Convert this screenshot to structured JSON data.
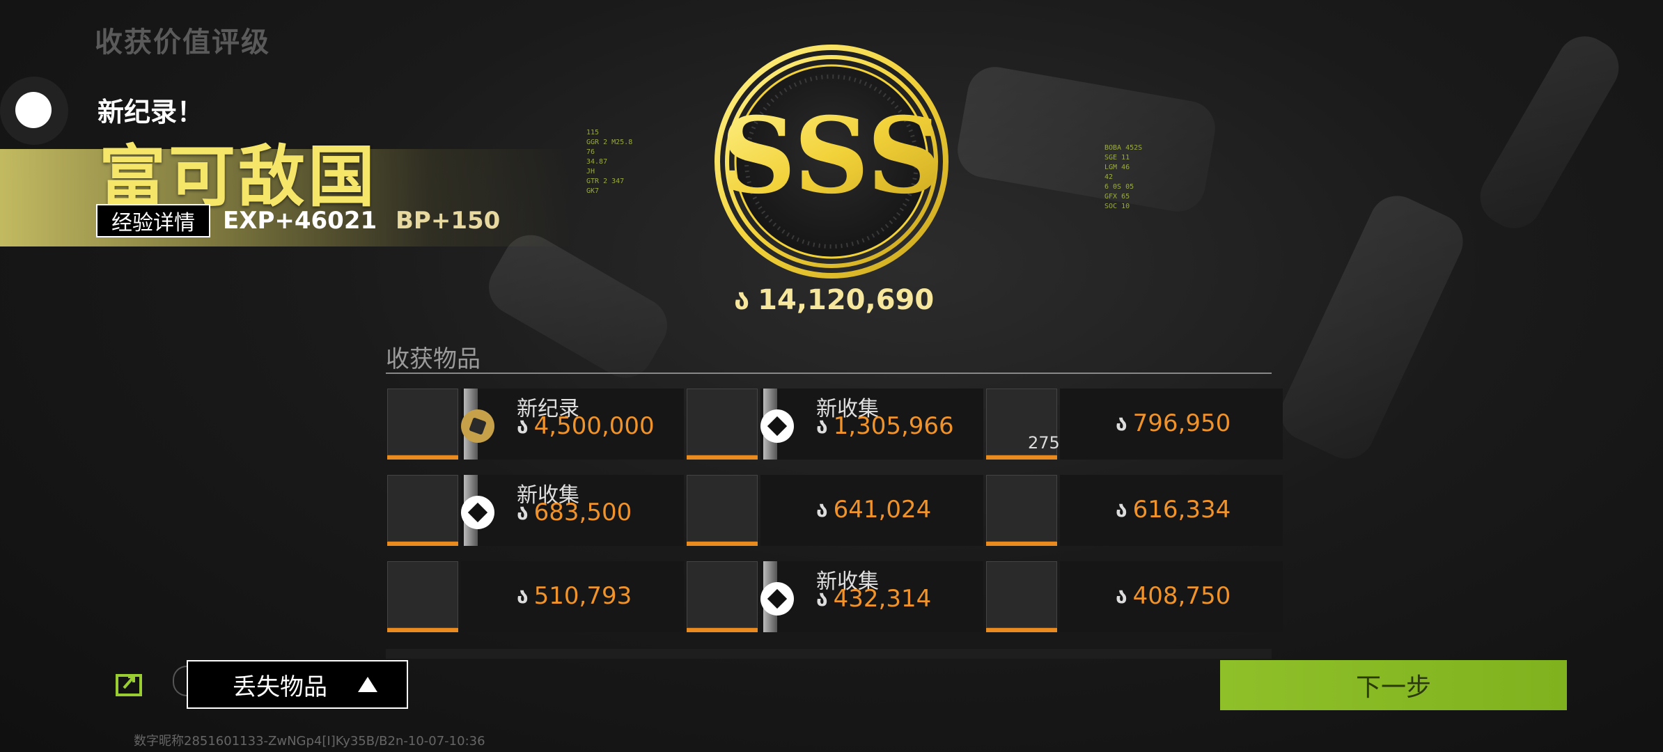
{
  "header": {
    "title": "收获价值评级"
  },
  "record": {
    "label": "新纪录！",
    "title": "富可敌国",
    "exp_button": "经验详情",
    "exp": "EXP+46021",
    "bp": "BP+150"
  },
  "rank": {
    "grade": "SSS",
    "total_value": "14,120,690",
    "currency_icon": "currency-icon"
  },
  "hud_left": [
    "115",
    "GGR 2 M25.8",
    "76",
    "34.87",
    "JH",
    "GTR 2 347",
    "GK7"
  ],
  "hud_right": [
    "BOBA 452S",
    "SGE 11",
    "LGM 46",
    "42",
    "6 0S 05",
    "GFX 65",
    "SOC 10"
  ],
  "collected": {
    "title": "收获物品",
    "items": [
      {
        "tag": "新纪录",
        "value": "4,500,000",
        "badge": "gold"
      },
      {
        "tag": "新收集",
        "value": "1,305,966",
        "badge": "white"
      },
      {
        "tag": "",
        "value": "796,950",
        "badge": "",
        "count": "275"
      },
      {
        "tag": "新收集",
        "value": "683,500",
        "badge": "white"
      },
      {
        "tag": "",
        "value": "641,024",
        "badge": ""
      },
      {
        "tag": "",
        "value": "616,334",
        "badge": ""
      },
      {
        "tag": "",
        "value": "510,793",
        "badge": ""
      },
      {
        "tag": "新收集",
        "value": "432,314",
        "badge": "white"
      },
      {
        "tag": "",
        "value": "408,750",
        "badge": ""
      }
    ]
  },
  "footer": {
    "lost_items": "丢失物品",
    "next": "下一步",
    "id_text": "数字昵称2851601133-ZwNGp4[I]Ky35B/B2n-10-07-10:36"
  },
  "colors": {
    "accent_green": "#8fc02a",
    "value_orange": "#f0932a",
    "gold": "#f5e66a"
  }
}
